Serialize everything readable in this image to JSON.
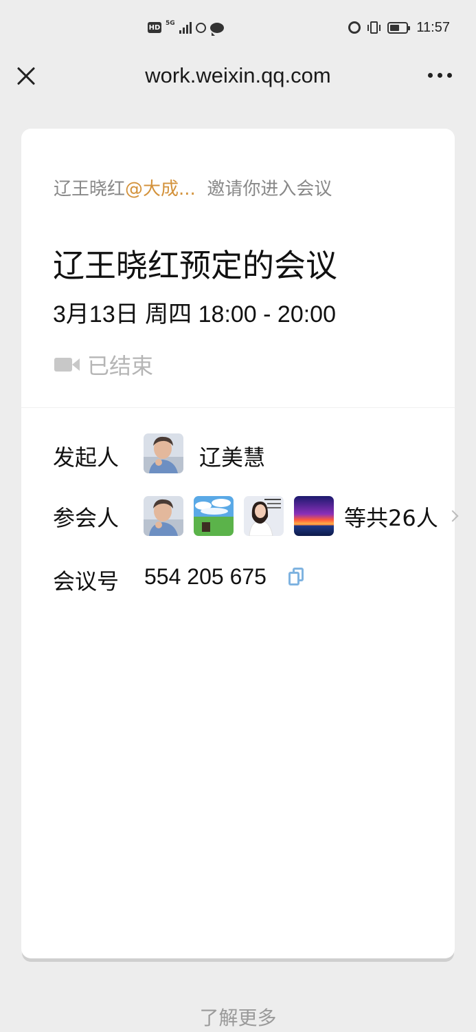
{
  "status_bar": {
    "hd": "HD",
    "network": "5G",
    "time": "11:57",
    "battery_level": 0.6,
    "icons": [
      "hd-icon",
      "signal-icon",
      "circle-icon",
      "message-icon",
      "alarm-icon",
      "vibrate-icon",
      "battery-icon"
    ]
  },
  "title_bar": {
    "url": "work.weixin.qq.com",
    "close_icon": "close-icon",
    "more_icon": "more-icon"
  },
  "card": {
    "inviter": "辽王晓红",
    "mention": "@大成...",
    "invite_text": "邀请你进入会议",
    "title": "辽王晓红预定的会议",
    "time": "3月13日 周四 18:00 - 20:00",
    "status": "已结束",
    "organizer_label": "发起人",
    "organizer_name": "辽美慧",
    "attendees_label": "参会人",
    "attendees_count": "等共26人",
    "meeting_id_label": "会议号",
    "meeting_id": "554 205 675"
  },
  "footer": {
    "learn_more": "了解更多"
  },
  "colors": {
    "background": "#ededed",
    "card": "#ffffff",
    "mention": "#d3923b",
    "muted": "#888888",
    "copy_icon": "#7fb3e0"
  }
}
